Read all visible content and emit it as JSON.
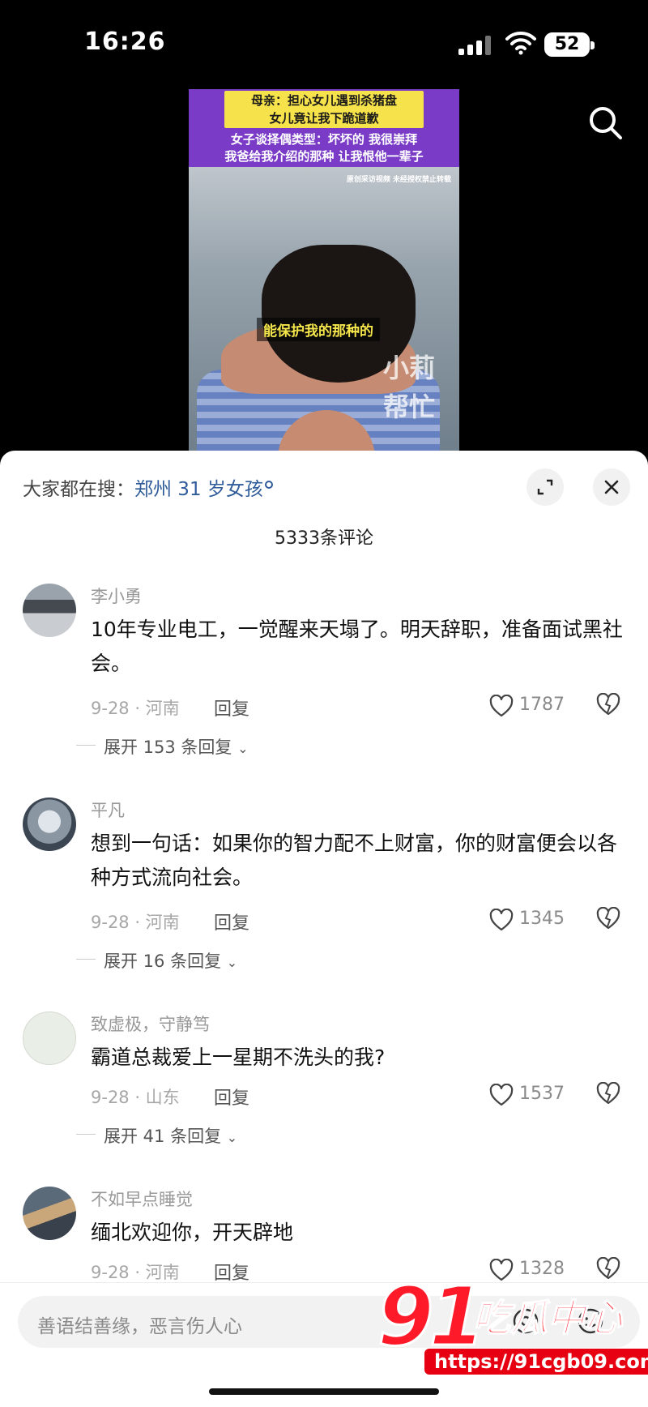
{
  "status_bar": {
    "time": "16:26",
    "battery": "52"
  },
  "video": {
    "banner_line1": "母亲：担心女儿遇到杀猪盘",
    "banner_line2": "女儿竟让我下跪道歉",
    "banner_line3": "女子谈择偶类型：坏坏的 我很崇拜",
    "banner_line4": "我爸给我介绍的那种 让我恨他一辈子",
    "notice": "原创采访视频 未经授权禁止转载",
    "subtitle": "能保护我的那种的",
    "watermark_line1": "小莉",
    "watermark_line2": "帮忙"
  },
  "panel": {
    "search_hint_prefix": "大家都在搜：",
    "search_hint_link": "郑州 31 岁女孩",
    "comment_count": "5333条评论"
  },
  "comments": [
    {
      "user": "李小勇",
      "text": "10年专业电工，一觉醒来天塌了。明天辞职，准备面试黑社会。",
      "meta": "9-28 · 河南",
      "reply": "回复",
      "likes": "1787",
      "expand": "展开 153 条回复"
    },
    {
      "user": "平凡",
      "text": "想到一句话：如果你的智力配不上财富，你的财富便会以各种方式流向社会。",
      "meta": "9-28 · 河南",
      "reply": "回复",
      "likes": "1345",
      "expand": "展开 16 条回复"
    },
    {
      "user": "致虚极，守静笃",
      "text": "霸道总裁爱上一星期不洗头的我?",
      "meta": "9-28 · 山东",
      "reply": "回复",
      "likes": "1537",
      "expand": "展开 41 条回复"
    },
    {
      "user": "不如早点睡觉",
      "text": "缅北欢迎你，开天辟地",
      "meta": "9-28 · 河南",
      "reply": "回复",
      "likes": "1328",
      "expand": ""
    }
  ],
  "input": {
    "placeholder": "善语结善缘，恶言伤人心"
  },
  "watermark": {
    "logo_number": "91",
    "logo_text": "吃瓜中心",
    "url": "https://91cgb09.com"
  },
  "icons": [
    "signal-icon",
    "wifi-icon",
    "battery-icon",
    "search-icon",
    "expand-icon",
    "close-icon",
    "heart-icon",
    "dislike-icon",
    "at-icon",
    "emoji-icon"
  ],
  "colors": {
    "link": "#2f5b9a",
    "watermark_red": "#ff1a2a",
    "banner_yellow": "#f6e24a",
    "banner_purple": "#7a3cc7"
  }
}
